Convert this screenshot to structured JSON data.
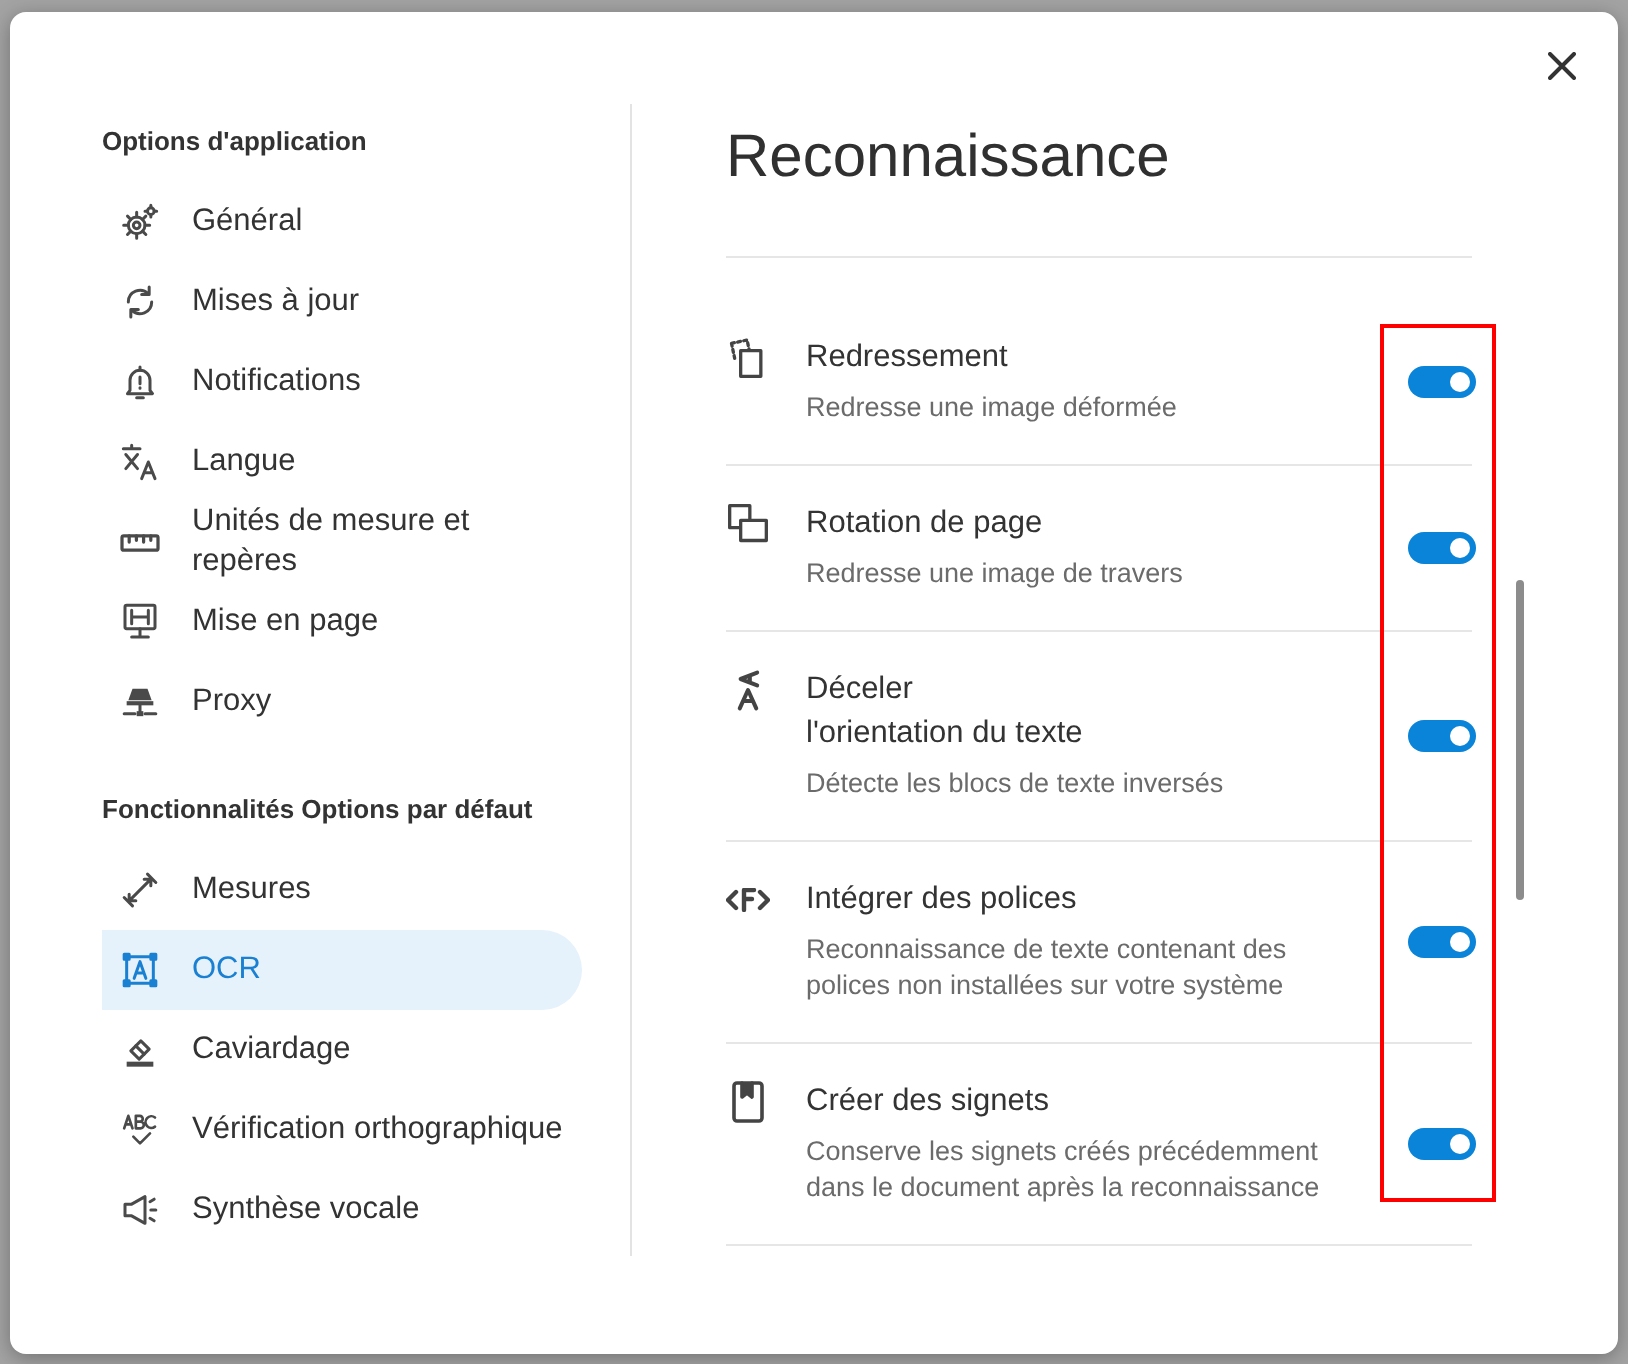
{
  "sidebar": {
    "groups": [
      {
        "heading": "Options d'application",
        "items": [
          {
            "label": "Général",
            "selected": false
          },
          {
            "label": "Mises à jour",
            "selected": false
          },
          {
            "label": "Notifications",
            "selected": false
          },
          {
            "label": "Langue",
            "selected": false
          },
          {
            "label": "Unités de mesure et\nrepères",
            "selected": false
          },
          {
            "label": "Mise en page",
            "selected": false
          },
          {
            "label": "Proxy",
            "selected": false
          }
        ]
      },
      {
        "heading": "Fonctionnalités Options par défaut",
        "items": [
          {
            "label": "Mesures",
            "selected": false
          },
          {
            "label": "OCR",
            "selected": true
          },
          {
            "label": "Caviardage",
            "selected": false
          },
          {
            "label": "Vérification orthographique",
            "selected": false
          },
          {
            "label": "Synthèse vocale",
            "selected": false
          }
        ]
      }
    ]
  },
  "panel": {
    "title": "Reconnaissance",
    "options": [
      {
        "title": "Redressement",
        "description": "Redresse une image déformée",
        "on": true
      },
      {
        "title": "Rotation de page",
        "description": "Redresse une image de travers",
        "on": true
      },
      {
        "title": "Déceler\nl'orientation du texte",
        "description": "Détecte les blocs de texte inversés",
        "on": true
      },
      {
        "title": "Intégrer des polices",
        "description": "Reconnaissance de texte contenant des polices non installées sur votre système",
        "on": true
      },
      {
        "title": "Créer des signets",
        "description": "Conserve les signets créés précédemment dans le document après la reconnaissance",
        "on": true
      }
    ]
  }
}
